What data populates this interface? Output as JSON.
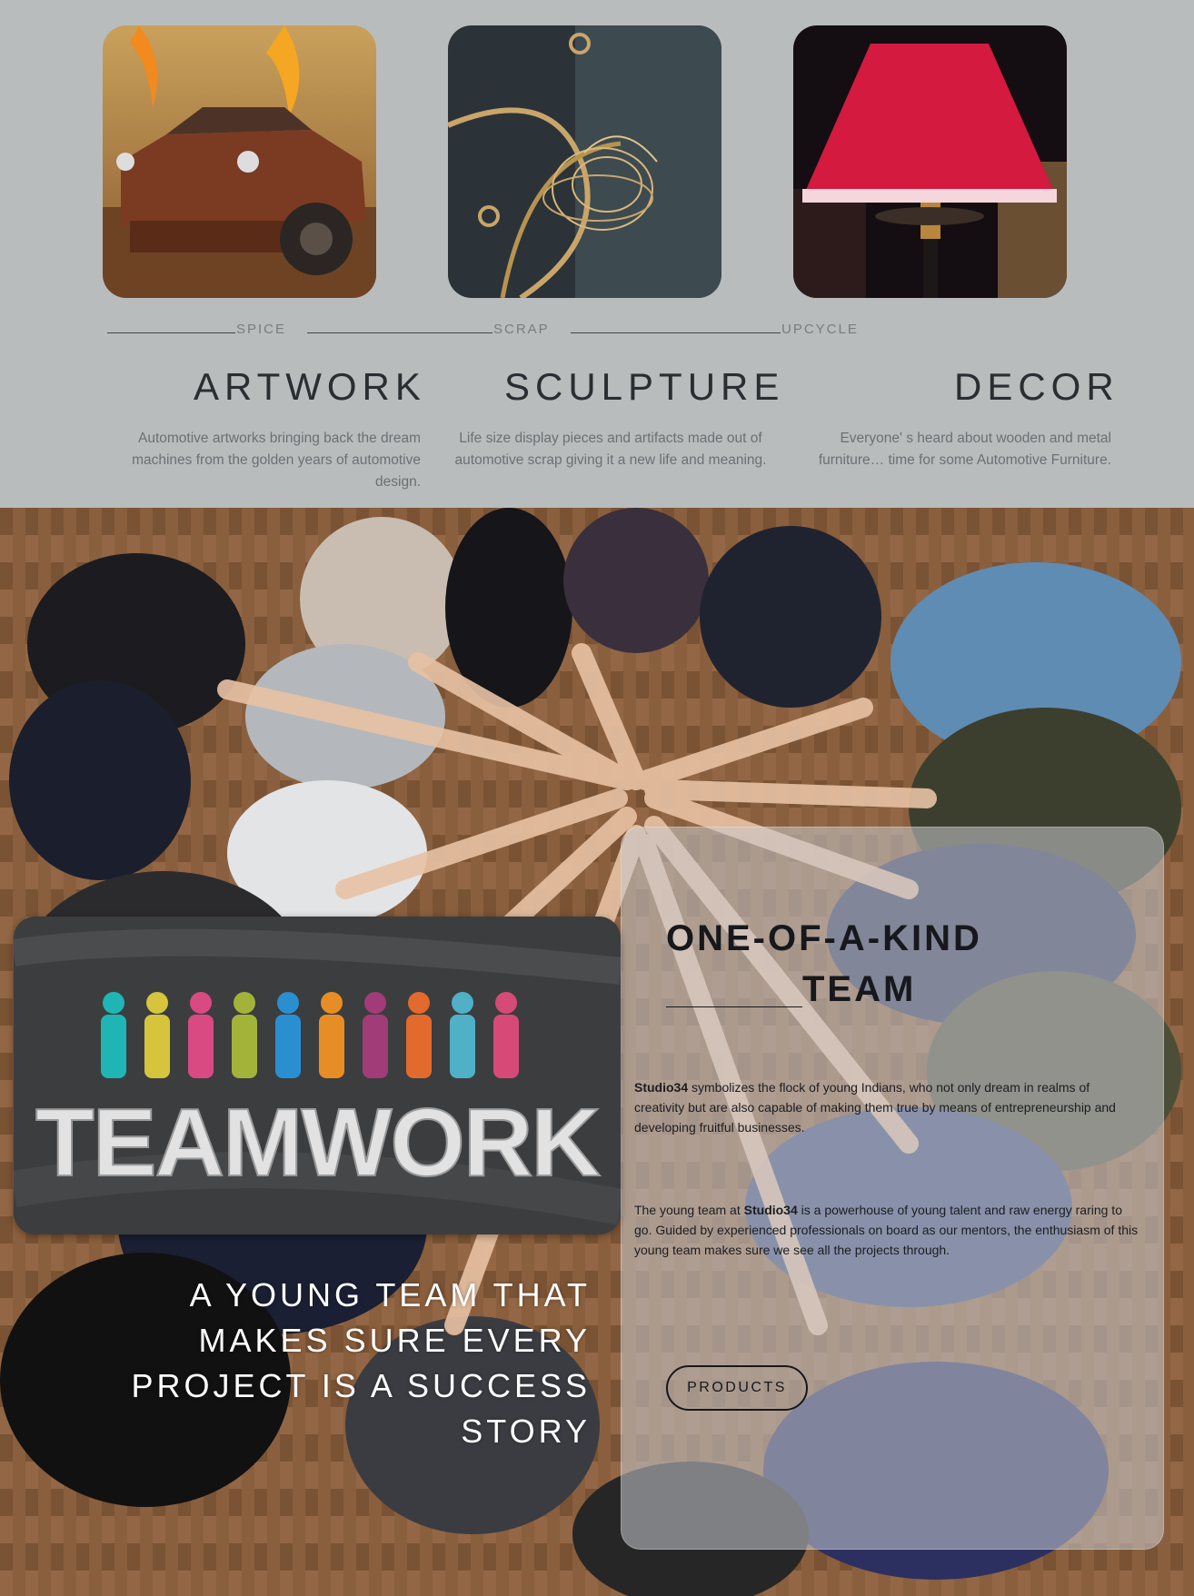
{
  "services": {
    "items": [
      {
        "kicker": "SPICE",
        "title": "ARTWORK",
        "description": "Automotive artworks bringing back the dream machines from the golden years of automotive design.",
        "image_icon": "hot-rod-car-artwork"
      },
      {
        "kicker": "SCRAP",
        "title": "SCULPTURE",
        "description": "Life size display pieces and artifacts made out of automotive scrap giving it a new life and meaning.",
        "image_icon": "scrap-metal-sculpture"
      },
      {
        "kicker": "UPCYCLE",
        "title": "DECOR",
        "description": "Everyone' s heard about wooden and metal furniture… time for some Automotive Furniture.",
        "image_icon": "red-lamp-gear"
      }
    ]
  },
  "team": {
    "background_icon": "team-hands-together-photo",
    "card_icon": "teamwork-chalkboard",
    "card_word": "TEAMWORK",
    "tagline": "A YOUNG TEAM THAT MAKES SURE EVERY PROJECT IS A SUCCESS STORY",
    "heading_line1": "ONE-OF-A-KIND",
    "heading_line2": "TEAM",
    "paragraph1_brand": "Studio34",
    "paragraph1_text": " symbolizes the flock of young Indians, who not only dream in realms of creativity but are also capable of making them true by means of entrepreneurship and developing fruitful businesses.",
    "paragraph2_prefix": "The young team at ",
    "paragraph2_brand": "Studio34",
    "paragraph2_text": " is a powerhouse of young talent and raw energy raring to go. Guided by experienced professionals on board as our mentors, the enthusiasm of this young team makes sure we see all the projects through.",
    "button_label": "PRODUCTS"
  },
  "colors": {
    "section_bg": "#b9bcbd",
    "heading": "#2a2e33",
    "muted_text": "#6b7075",
    "panel_glass": "rgba(200,203,208,0.55)"
  }
}
